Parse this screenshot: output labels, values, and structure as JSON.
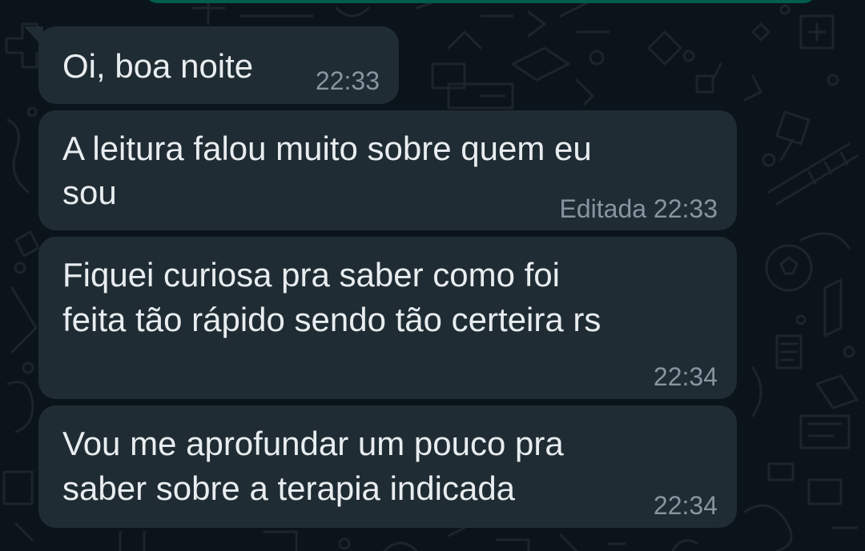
{
  "chat": {
    "messages": [
      {
        "lines": [
          "Oi, boa noite"
        ],
        "edited_label": "",
        "time": "22:33"
      },
      {
        "lines": [
          "A leitura falou muito sobre quem eu",
          "sou"
        ],
        "edited_label": "Editada",
        "time": "22:33"
      },
      {
        "lines": [
          "Fiquei curiosa pra saber como foi",
          "feita tão rápido sendo tão certeira rs"
        ],
        "edited_label": "",
        "time": "22:34"
      },
      {
        "lines": [
          "Vou me aprofundar um pouco pra",
          "saber sobre a terapia indicada"
        ],
        "edited_label": "",
        "time": "22:34"
      }
    ]
  },
  "colors": {
    "background": "#0b141a",
    "incoming_bubble": "#1f2c34",
    "outgoing_bubble": "#005c4b",
    "message_text": "#e9edef",
    "meta_text": "#8696a0"
  }
}
